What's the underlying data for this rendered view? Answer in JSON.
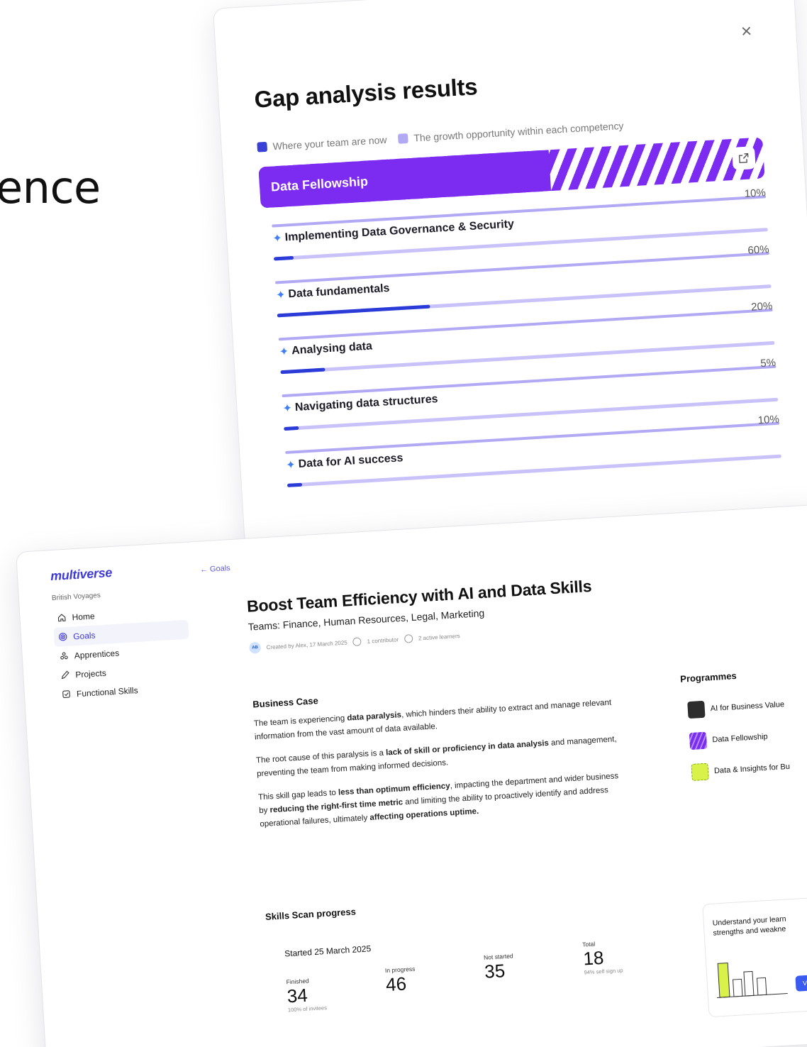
{
  "hero": {
    "word": "ence"
  },
  "gap_analysis": {
    "close_label": "×",
    "title": "Gap analysis results",
    "legend": {
      "now": "Where your team are now",
      "growth": "The growth opportunity within each competency"
    },
    "programme": {
      "name": "Data Fellowship",
      "icon": "external-link-icon"
    },
    "competencies": [
      {
        "name": "Implementing Data Governance & Security",
        "percent_label": "10%",
        "progress": 0.04
      },
      {
        "name": "Data fundamentals",
        "percent_label": "60%",
        "progress": 0.31
      },
      {
        "name": "Analysing data",
        "percent_label": "20%",
        "progress": 0.09
      },
      {
        "name": "Navigating data structures",
        "percent_label": "5%",
        "progress": 0.03
      },
      {
        "name": "Data for AI success",
        "percent_label": "10%",
        "progress": 0.03
      }
    ],
    "colors": {
      "programme": "#7c2bf0",
      "now": "#2b3bd8",
      "growth": "#b2a9f5"
    }
  },
  "app": {
    "logo": "multiverse",
    "org": "British Voyages",
    "nav": [
      {
        "label": "Home",
        "icon": "home-icon"
      },
      {
        "label": "Goals",
        "icon": "target-icon",
        "active": true
      },
      {
        "label": "Apprentices",
        "icon": "people-icon"
      },
      {
        "label": "Projects",
        "icon": "pencil-icon"
      },
      {
        "label": "Functional Skills",
        "icon": "checklist-icon"
      }
    ],
    "back_link": "← Goals",
    "goal": {
      "title": "Boost Team Efficiency with AI and Data Skills",
      "teams": "Teams: Finance, Human Resources, Legal, Marketing",
      "meta": {
        "avatar": "AB",
        "created": "Created by Alex, 17 March 2025",
        "contributors": "1 contributor",
        "learners": "2 active learners"
      }
    },
    "business_case": {
      "heading": "Business Case",
      "p1_a": "The team is experiencing ",
      "p1_b": "data paralysis",
      "p1_c": ", which hinders their ability to extract and manage relevant information from the vast amount of data available.",
      "p2_a": "The root cause of this paralysis is a ",
      "p2_b": "lack of skill or proficiency in data analysis",
      "p2_c": " and management, preventing the team from making informed decisions.",
      "p3_a": "This skill gap leads to ",
      "p3_b": "less than optimum efficiency",
      "p3_c": ", impacting the department and wider business by ",
      "p3_d": "reducing the right-first time metric",
      "p3_e": " and limiting the ability to proactively identify and address operational failures, ultimately ",
      "p3_f": "affecting operations uptime."
    },
    "skills_scan": {
      "heading": "Skills Scan progress",
      "started": "Started 25 March 2025",
      "finished": {
        "label": "Finished",
        "value": "34",
        "sub": "100% of invitees"
      },
      "in_progress": {
        "label": "In progress",
        "value": "46"
      },
      "not_started": {
        "label": "Not started",
        "value": "35"
      },
      "total": {
        "label": "Total",
        "value": "18",
        "sub": "94% self sign up"
      }
    },
    "programmes": {
      "heading": "Programmes",
      "items": [
        "AI for Business Value",
        "Data Fellowship",
        "Data & Insights for Bu"
      ]
    },
    "insight": {
      "line1": "Understand your learn",
      "line2": "strengths and weakne",
      "button": "Vie"
    }
  }
}
